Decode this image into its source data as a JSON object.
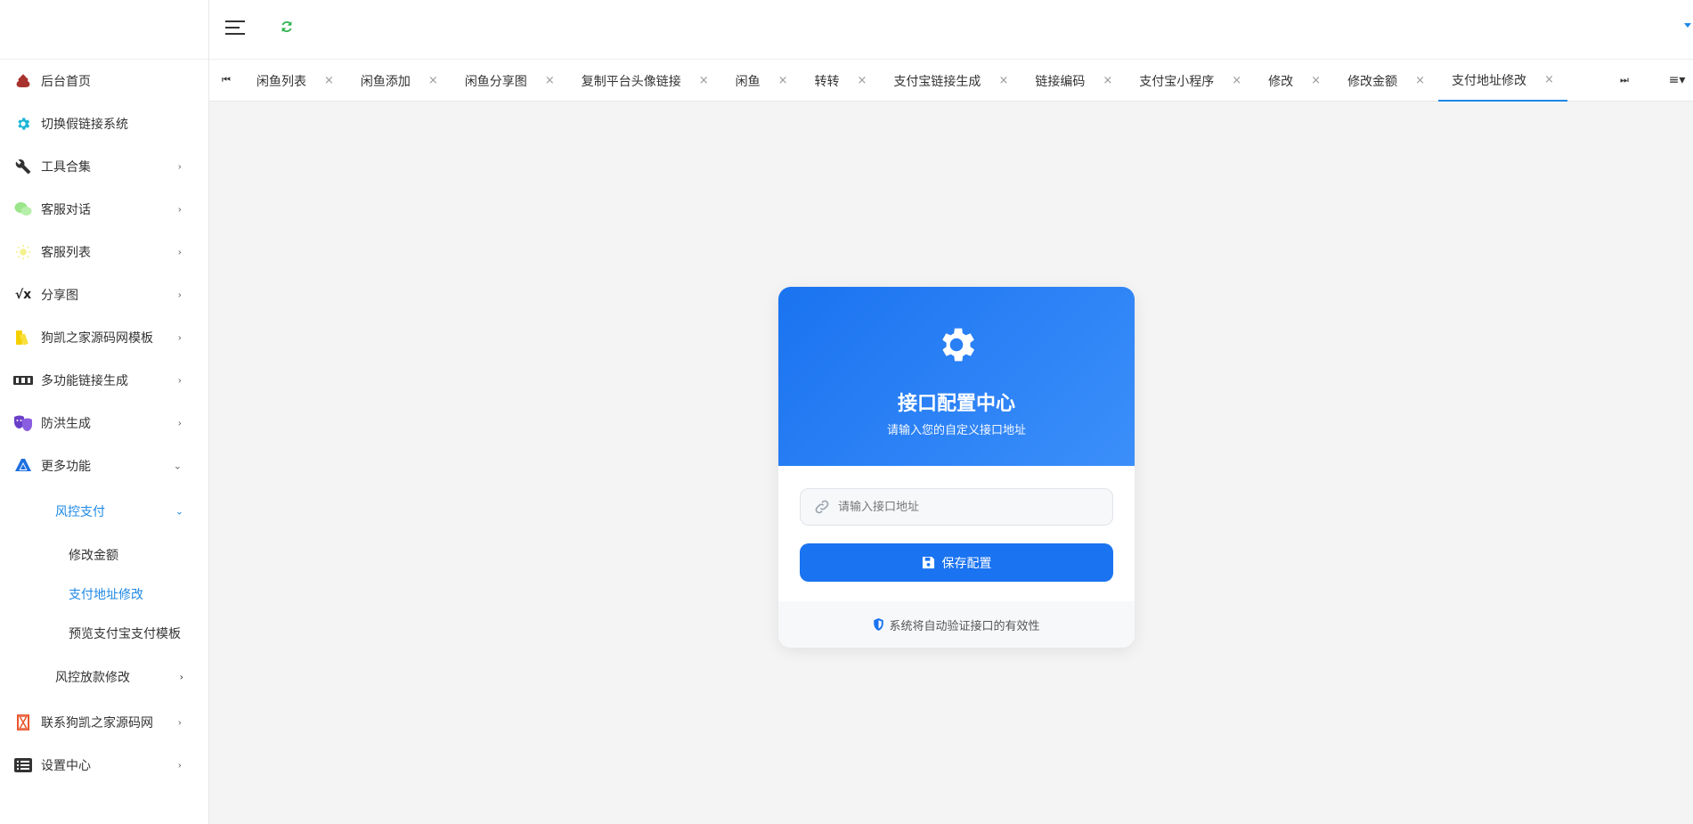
{
  "sidebar": {
    "items": [
      {
        "label": "后台首页",
        "icon": "poop-icon",
        "arrow": ""
      },
      {
        "label": "切换假链接系统",
        "icon": "gear-icon",
        "arrow": ""
      },
      {
        "label": "工具合集",
        "icon": "wrench-icon",
        "arrow": "›"
      },
      {
        "label": "客服对话",
        "icon": "wechat-icon",
        "arrow": "›"
      },
      {
        "label": "客服列表",
        "icon": "sun-icon",
        "arrow": "›"
      },
      {
        "label": "分享图",
        "icon": "square-root-icon",
        "arrow": "›"
      },
      {
        "label": "狗凯之家源码网模板",
        "icon": "swatch-icon",
        "arrow": "›"
      },
      {
        "label": "多功能链接生成",
        "icon": "film-icon",
        "arrow": "›"
      },
      {
        "label": "防洪生成",
        "icon": "masks-icon",
        "arrow": "›"
      },
      {
        "label": "更多功能",
        "icon": "delta-icon",
        "arrow": "⌄"
      }
    ],
    "sub_active": {
      "label": "风控支付",
      "arrow": "⌄"
    },
    "subsub": [
      {
        "label": "修改金额"
      },
      {
        "label": "支付地址修改"
      },
      {
        "label": "预览支付宝支付模板"
      }
    ],
    "sub_other": {
      "label": "风控放款修改",
      "arrow": "›"
    },
    "bottom_items": [
      {
        "label": "联系狗凯之家源码网",
        "icon": "hourglass-icon",
        "arrow": "›"
      },
      {
        "label": "设置中心",
        "icon": "list-icon",
        "arrow": "›"
      }
    ]
  },
  "tabbar": {
    "left_nav": "⏮",
    "right_nav": "⏭",
    "menu": "≡▾",
    "close_glyph": "×",
    "tabs": [
      {
        "label": "闲鱼列表"
      },
      {
        "label": "闲鱼添加"
      },
      {
        "label": "闲鱼分享图"
      },
      {
        "label": "复制平台头像链接"
      },
      {
        "label": "闲鱼"
      },
      {
        "label": "转转"
      },
      {
        "label": "支付宝链接生成"
      },
      {
        "label": "链接编码"
      },
      {
        "label": "支付宝小程序"
      },
      {
        "label": "修改"
      },
      {
        "label": "修改金额"
      },
      {
        "label": "支付地址修改"
      }
    ],
    "active_index": 11
  },
  "card": {
    "title": "接口配置中心",
    "subtitle": "请输入您的自定义接口地址",
    "input_placeholder": "请输入接口地址",
    "input_value": "",
    "save_label": "保存配置",
    "footer_note": "系统将自动验证接口的有效性"
  },
  "colors": {
    "accent": "#1e88e5",
    "card_header": "#1a73f0",
    "refresh": "#2bb24c"
  }
}
